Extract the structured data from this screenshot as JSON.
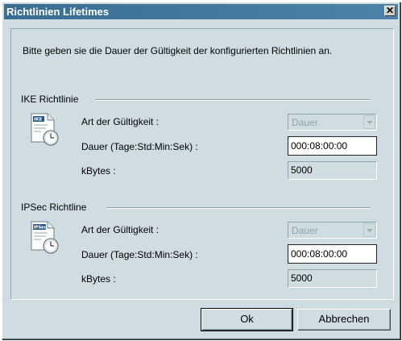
{
  "window": {
    "title": "Richtlinien Lifetimes",
    "close_glyph": "✕"
  },
  "intro_text": "Bitte geben sie die Dauer der Gültigkeit der konfigurierten Richtlinien an.",
  "ike": {
    "group_title": "IKE Richtlinie",
    "icon_label": "IKE",
    "type_label": "Art der Gültigkeit :",
    "type_value": "Dauer",
    "duration_label": "Dauer (Tage:Std:Min:Sek) :",
    "duration_value": "000:08:00:00",
    "kbytes_label": "kBytes :",
    "kbytes_value": "5000"
  },
  "ipsec": {
    "group_title": "IPSec Richtline",
    "icon_label": "IPSec",
    "type_label": "Art der Gültigkeit :",
    "type_value": "Dauer",
    "duration_label": "Dauer (Tage:Std:Min:Sek) :",
    "duration_value": "000:08:00:00",
    "kbytes_label": "kBytes :",
    "kbytes_value": "5000"
  },
  "buttons": {
    "ok": "Ok",
    "cancel": "Abbrechen"
  },
  "colors": {
    "titlebar": "#4a7fa4",
    "dialog_bg": "#cfdde2"
  }
}
